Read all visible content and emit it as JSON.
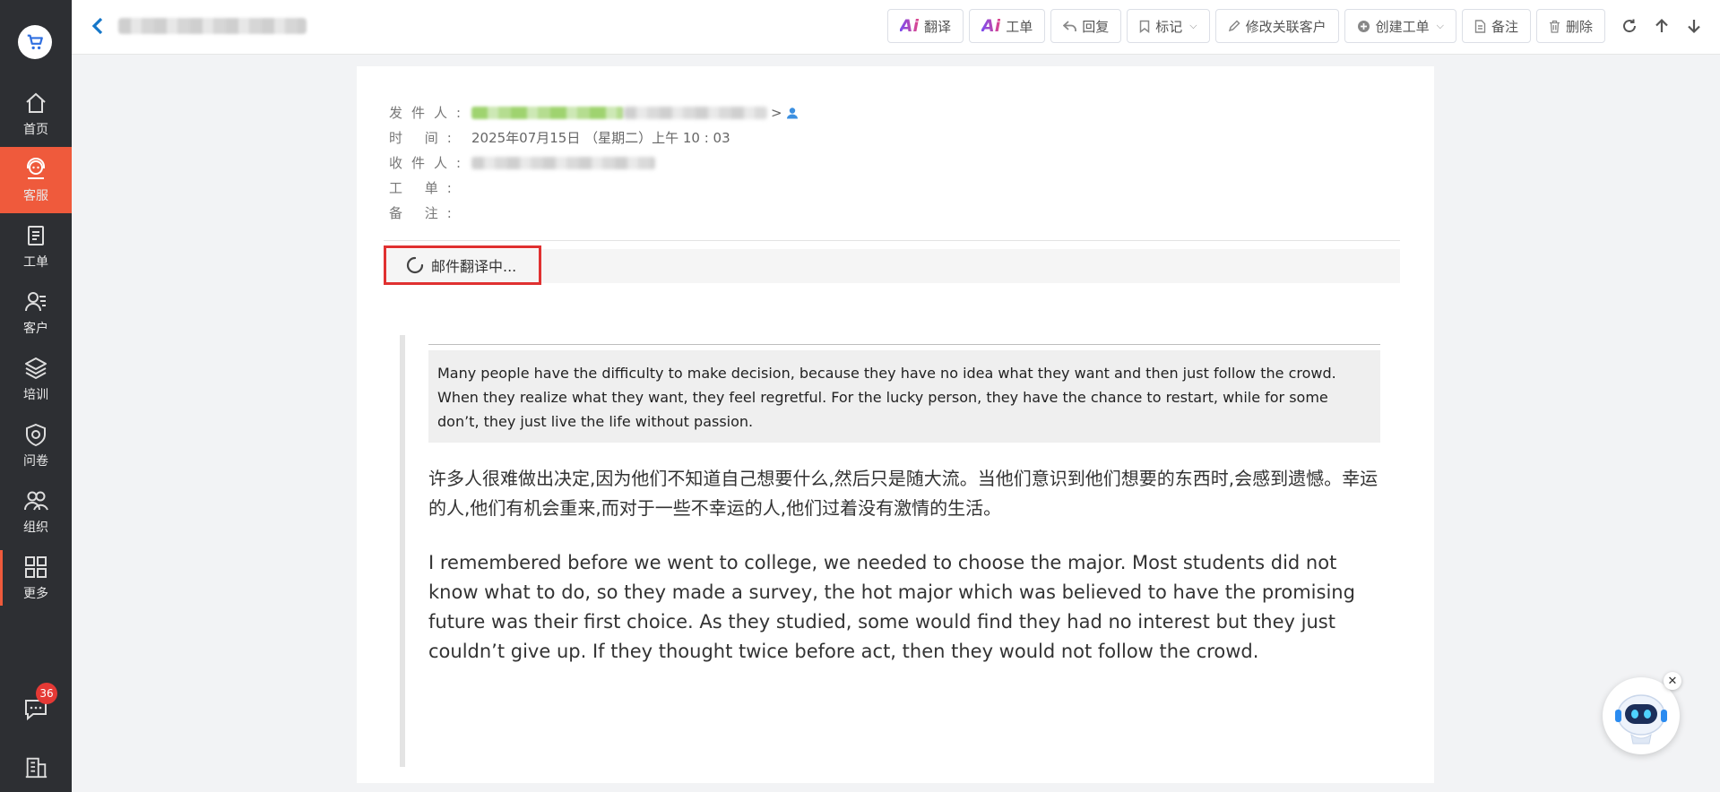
{
  "sidebar": {
    "items": [
      {
        "label": "首页",
        "icon": "home-icon"
      },
      {
        "label": "客服",
        "icon": "headset-icon",
        "active": true
      },
      {
        "label": "工单",
        "icon": "clipboard-icon"
      },
      {
        "label": "客户",
        "icon": "customer-icon"
      },
      {
        "label": "培训",
        "icon": "layers-icon"
      },
      {
        "label": "问卷",
        "icon": "shield-icon"
      },
      {
        "label": "组织",
        "icon": "team-icon"
      },
      {
        "label": "更多",
        "icon": "grid-icon"
      }
    ],
    "chat_badge": "36"
  },
  "toolbar": {
    "ai_translate": "翻译",
    "ai_ticket": "工单",
    "reply": "回复",
    "mark": "标记",
    "edit_customer": "修改关联客户",
    "create_ticket": "创建工单",
    "note": "备注",
    "delete": "删除"
  },
  "email": {
    "sender_label": "发件人:",
    "time_label": "时 间:",
    "time_value": "2025年07月15日 （星期二）上午 10 : 03",
    "recipient_label": "收件人:",
    "ticket_label": "工 单:",
    "note_label": "备 注:",
    "translating": "邮件翻译中...",
    "quote_en": "Many people have the difficulty to make decision, because they have no idea what they want and then just follow the crowd. When they realize what they want, they feel regretful. For the lucky person, they have the chance to restart, while for some don’t, they just live the life without passion.",
    "quote_zh": "许多人很难做出决定,因为他们不知道自己想要什么,然后只是随大流。当他们意识到他们想要的东西时,会感到遗憾。幸运的人,他们有机会重来,而对于一些不幸运的人,他们过着没有激情的生活。",
    "body": "I remembered before we went to college, we needed to choose the major. Most students did not know what to do, so they made a survey, the hot major which was believed to have the promising future was their first choice. As they studied, some would find they had no interest but they just couldn’t give up. If they thought twice before act, then they would not follow the crowd."
  },
  "colors": {
    "sidebar_bg": "#2d2f33",
    "active": "#ef5a3c",
    "highlight_border": "#e03131",
    "badge": "#e53935"
  }
}
